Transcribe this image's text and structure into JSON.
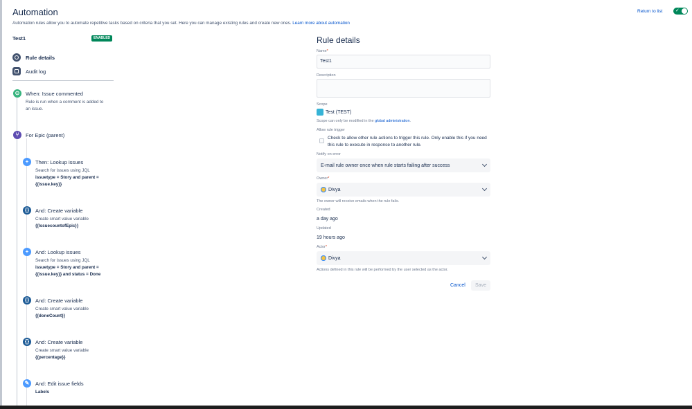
{
  "header": {
    "title": "Automation",
    "intro": "Automation rules allow you to automate repetitive tasks based on criteria that you set. Here you can manage existing rules and create new ones.",
    "intro_link": "Learn more about automation",
    "return_link": "Return to list",
    "toggle_state": "on"
  },
  "sidebar": {
    "rule_name": "Test1",
    "status_badge": "ENABLED",
    "nav": [
      {
        "label": "Rule details",
        "icon": "rule-details-icon",
        "active": true
      },
      {
        "label": "Audit log",
        "icon": "audit-log-icon",
        "active": false
      }
    ],
    "steps": [
      {
        "title": "When: Issue commented",
        "desc": "Rule is run when a comment is added to an issue.",
        "icon": "trigger-icon",
        "color": "#36b37e"
      },
      {
        "title": "For Epic (parent)",
        "desc": "",
        "icon": "branch-icon",
        "color": "#5e4db2"
      },
      {
        "title": "Then: Lookup issues",
        "desc_prefix": "Search for issues using JQL",
        "desc_bold": "issuetype = Story and parent = {{issue.key}}",
        "icon": "action-icon",
        "color": "#4c9aff"
      },
      {
        "title": "And: Create variable",
        "desc_prefix": "Create smart value variable",
        "desc_bold": "{{IssuecountofEpic}}",
        "icon": "variable-icon",
        "color": "#1d5b96"
      },
      {
        "title": "And: Lookup issues",
        "desc_prefix": "Search for issues using JQL",
        "desc_bold": "issuetype = Story and parent = {{issue.key}} and status = Done",
        "icon": "action-icon",
        "color": "#4c9aff"
      },
      {
        "title": "And: Create variable",
        "desc_prefix": "Create smart value variable",
        "desc_bold": "{{doneCount}}",
        "icon": "variable-icon",
        "color": "#1d5b96"
      },
      {
        "title": "And: Create variable",
        "desc_prefix": "Create smart value variable",
        "desc_bold": "{{percentage}}",
        "icon": "variable-icon",
        "color": "#1d5b96"
      },
      {
        "title": "And: Edit issue fields",
        "desc_prefix": "",
        "desc_bold": "Labels",
        "icon": "edit-icon",
        "color": "#4c9aff"
      }
    ]
  },
  "details": {
    "title": "Rule details",
    "name_label": "Name",
    "name_value": "Test1",
    "description_label": "Description",
    "description_value": "",
    "scope_label": "Scope",
    "scope_value": "Test (TEST)",
    "scope_helper": "Scope can only be modified in the",
    "scope_helper_link": "global administration",
    "allow_trigger_label": "Allow rule trigger",
    "allow_trigger_text": "Check to allow other rule actions to trigger this rule. Only enable this if you need this rule to execute in response to another rule.",
    "allow_trigger_checked": false,
    "notify_label": "Notify on error",
    "notify_value": "E-mail rule owner once when rule starts failing after success",
    "owner_label": "Owner",
    "owner_value": "Divya",
    "owner_helper": "The owner will receive emails when the rule fails.",
    "created_label": "Created",
    "created_value": "a day ago",
    "updated_label": "Updated",
    "updated_value": "19 hours ago",
    "actor_label": "Actor",
    "actor_value": "Divya",
    "actor_helper": "Actions defined in this rule will be performed by the user selected as the actor.",
    "cancel_label": "Cancel",
    "save_label": "Save"
  }
}
